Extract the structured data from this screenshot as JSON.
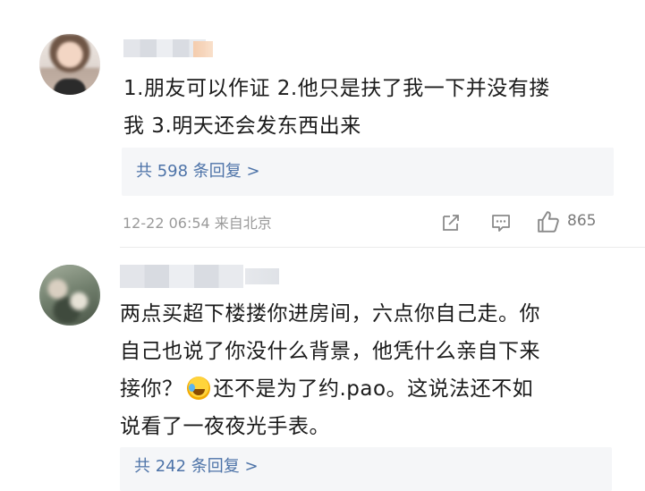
{
  "comments": [
    {
      "text_lines": [
        "1.朋友可以作证 2.他只是扶了我一下并没有搂",
        "我 3.明天还会发东西出来"
      ],
      "replies_label": "共 598 条回复 >",
      "timestamp": "12-22 06:54",
      "source": "来自北京",
      "likes": "865",
      "icons": [
        "share-icon",
        "comment-icon",
        "like-icon"
      ]
    },
    {
      "text_lines": [
        "两点买超下楼搂你进房间，六点你自己走。你",
        "自己也说了你没什么背景，他凭什么亲自下来",
        "接你？",
        "还不是为了约.pao。这说法还不如",
        "说看了一夜夜光手表。"
      ],
      "emoji": "laughing-crying-emoji",
      "replies_label": "共 242 条回复 >"
    }
  ],
  "colors": {
    "link": "#4d73a8",
    "meta": "#9a9a9a",
    "reply_bg": "#f5f6f8"
  }
}
